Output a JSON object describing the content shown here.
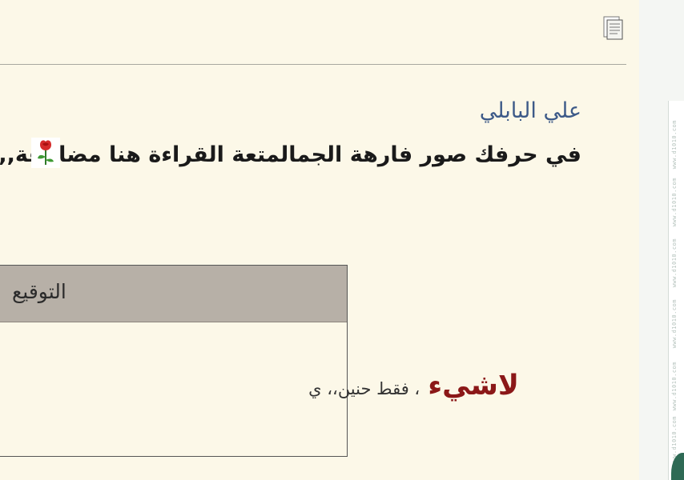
{
  "post": {
    "quote_author": "علي البابلي",
    "quote_text": "في حرفك صور فارهة الجمالمتعة القراءة هنا مضاعفة,,,"
  },
  "signature": {
    "header": "التوقيع",
    "strong_text": "لاشيء",
    "rest_text": "، فقط حنين،، ي"
  },
  "icons": {
    "document": "document-icon",
    "rose": "rose-icon"
  },
  "sidebar": {
    "watermarks": [
      "www.d1010.com",
      "www.d1010.com",
      "www.d1010.com",
      "www.d1010.com",
      "www.d1010.com",
      "www.d1010.com"
    ]
  },
  "colors": {
    "background": "#fcf8e8",
    "author": "#3d5a88",
    "signature_header": "#b7b0a7",
    "signature_strong": "#8b1818",
    "corner": "#2e6a55"
  }
}
